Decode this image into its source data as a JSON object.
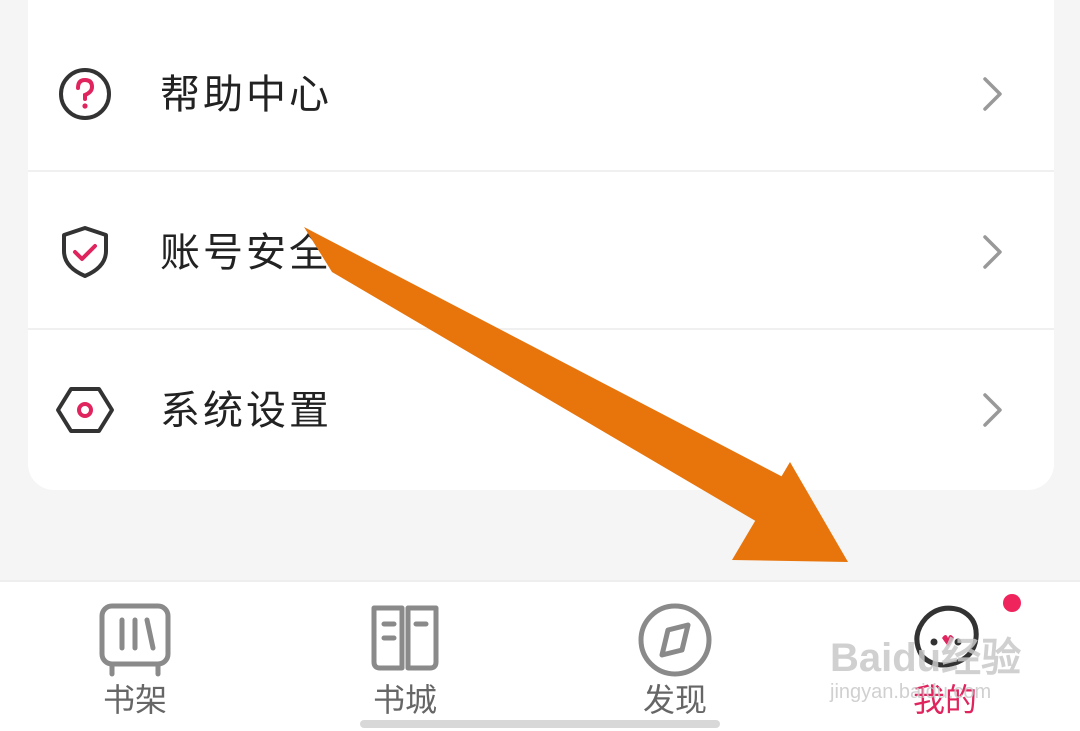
{
  "menu": {
    "items": [
      {
        "label": "帮助中心",
        "icon": "help-circle-icon"
      },
      {
        "label": "账号安全",
        "icon": "shield-check-icon"
      },
      {
        "label": "系统设置",
        "icon": "settings-hexagon-icon"
      }
    ]
  },
  "tabbar": {
    "tabs": [
      {
        "label": "书架",
        "icon": "bookshelf-icon",
        "active": false
      },
      {
        "label": "书城",
        "icon": "book-store-icon",
        "active": false
      },
      {
        "label": "发现",
        "icon": "compass-icon",
        "active": false
      },
      {
        "label": "我的",
        "icon": "profile-avatar-icon",
        "active": true,
        "badge": true
      }
    ]
  },
  "watermark": {
    "main": "Baidu经验",
    "sub": "jingyan.baidu.com"
  },
  "colors": {
    "accent": "#e0245e",
    "annotation_arrow": "#e8740c",
    "icon_stroke": "#333333"
  }
}
